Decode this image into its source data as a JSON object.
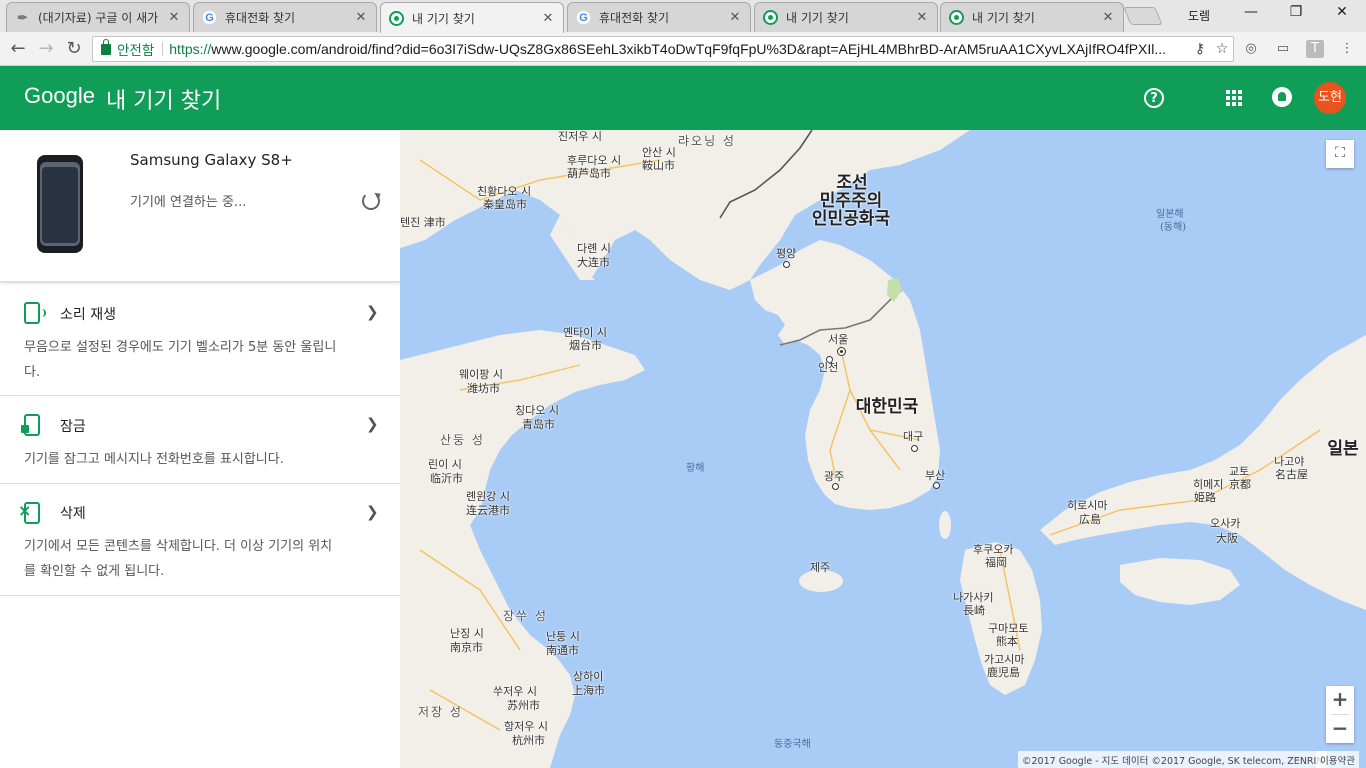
{
  "browser": {
    "tabs": [
      {
        "title": "(대기자료) 구글 이 새가",
        "favicon": "feather-icon",
        "active": false
      },
      {
        "title": "휴대전화 찾기",
        "favicon": "google-icon",
        "active": false
      },
      {
        "title": "내 기기 찾기",
        "favicon": "find-device-icon",
        "active": true
      },
      {
        "title": "휴대전화 찾기",
        "favicon": "google-icon",
        "active": false
      },
      {
        "title": "내 기기 찾기",
        "favicon": "find-device-icon",
        "active": false
      },
      {
        "title": "내 기기 찾기",
        "favicon": "find-device-icon",
        "active": false
      }
    ],
    "user": "도렘",
    "secure_label": "안전함",
    "url_scheme": "https://",
    "url_rest": "www.google.com/android/find?did=6o3I7iSdw-UQsZ8Gx86SEehL3xikbT4oDwTqF9fqFpU%3D&rapt=AEjHL4MBhrBD-ArAM5ruAA1CXyvLXAjIfRO4fPXIl..."
  },
  "appbar": {
    "brand": "Google",
    "title": "내 기기 찾기",
    "avatar_text": "도현",
    "color": "#0f9d58",
    "avatar_color": "#e8531f"
  },
  "device": {
    "name": "Samsung Galaxy S8+",
    "status": "기기에 연결하는 중..."
  },
  "actions": [
    {
      "title": "소리 재생",
      "desc": "무음으로 설정된 경우에도 기기 벨소리가 5분 동안 울립니다."
    },
    {
      "title": "잠금",
      "desc": "기기를 잠그고 메시지나 전화번호를 표시합니다."
    },
    {
      "title": "삭제",
      "desc": "기기에서 모든 콘텐츠를 삭제합니다. 더 이상 기기의 위치를 확인할 수 없게 됩니다."
    }
  ],
  "map": {
    "countries": {
      "north_korea_1": "조선",
      "north_korea_2": "민주주의",
      "north_korea_3": "인민공화국",
      "south_korea": "대한민국",
      "japan": "일본"
    },
    "seas": {
      "east_sea_1": "일본해",
      "east_sea_2": "(동해)",
      "yellow_sea": "황해",
      "east_china_sea": "동중국해"
    },
    "provinces": {
      "liaoning": "랴오닝 성",
      "shandong": "산둥 성",
      "jiangsu": "장쑤 성",
      "zhejiang": "저장 성"
    },
    "cities": {
      "pyongyang": "평양",
      "seoul": "서울",
      "incheon": "인천",
      "daegu": "대구",
      "gwangju": "광주",
      "busan": "부산",
      "jeju": "제주",
      "jinzhou": "진저우 시",
      "huludao_1": "후루다오 시",
      "huludao_2": "葫芦岛市",
      "anshan_1": "안산 시",
      "anshan_2": "鞍山市",
      "qinhuangdao_1": "친황다오 시",
      "qinhuangdao_2": "秦皇岛市",
      "tianjin": "텐진 津市",
      "dalian_1": "다롄 시",
      "dalian_2": "大连市",
      "yantai_1": "옌타이 시",
      "yantai_2": "烟台市",
      "weifang_1": "웨이팡 시",
      "weifang_2": "潍坊市",
      "qingdao_1": "칭다오 시",
      "qingdao_2": "青岛市",
      "linyi_1": "린이 시",
      "linyi_2": "临沂市",
      "lianyungang_1": "롄윈강 시",
      "lianyungang_2": "连云港市",
      "nanjing_1": "난징 시",
      "nanjing_2": "南京市",
      "nantong_1": "난퉁 시",
      "nantong_2": "南通市",
      "shanghai_1": "상하이",
      "shanghai_2": "上海市",
      "suzhou_1": "쑤저우 시",
      "suzhou_2": "苏州市",
      "hangzhou_1": "항저우 시",
      "hangzhou_2": "杭州市",
      "fukuoka_1": "후쿠오카",
      "fukuoka_2": "福岡",
      "nagasaki_1": "나가사키",
      "nagasaki_2": "長崎",
      "kumamoto_1": "구마모토",
      "kumamoto_2": "熊本",
      "kagoshima_1": "가고시마",
      "kagoshima_2": "鹿児島",
      "hiroshima_1": "히로시마",
      "hiroshima_2": "広島",
      "himeji_1": "히메지",
      "himeji_2": "姫路",
      "kyoto_1": "교토",
      "kyoto_2": "京都",
      "nagoya_1": "나고야",
      "nagoya_2": "名古屋",
      "osaka_1": "오사카",
      "osaka_2": "大阪"
    },
    "attribution": "©2017 Google - 지도 데이터 ©2017 Google, SK telecom, ZENRIN",
    "terms": "이용약관",
    "water_color": "#a9ccf7",
    "land_color": "#f2efe9"
  }
}
